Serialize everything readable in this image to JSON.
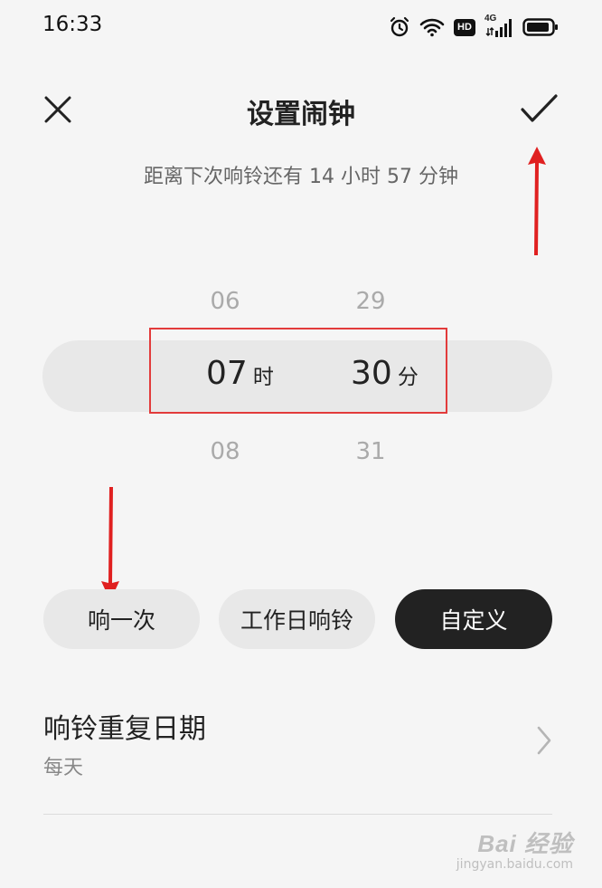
{
  "status_bar": {
    "time": "16:33",
    "hd_badge": "HD",
    "network_label": "4G"
  },
  "header": {
    "title": "设置闹钟"
  },
  "next_ring_text": "距离下次响铃还有 14 小时 57 分钟",
  "picker": {
    "hour_prev": "06",
    "hour_selected": "07",
    "hour_next": "08",
    "hour_unit": "时",
    "minute_prev": "29",
    "minute_selected": "30",
    "minute_next": "31",
    "minute_unit": "分"
  },
  "modes": {
    "once": "响一次",
    "workday": "工作日响铃",
    "custom": "自定义"
  },
  "repeat": {
    "title": "响铃重复日期",
    "value": "每天"
  },
  "watermark": {
    "main": "Bai 经验",
    "sub": "jingyan.baidu.com"
  },
  "colors": {
    "highlight": "#e23b3b",
    "selected_mode_bg": "#222222",
    "arrow": "#e02020"
  },
  "icons": [
    "close-icon",
    "check-icon",
    "alarm-icon",
    "wifi-icon",
    "signal-icon",
    "battery-icon",
    "chevron-right-icon"
  ]
}
